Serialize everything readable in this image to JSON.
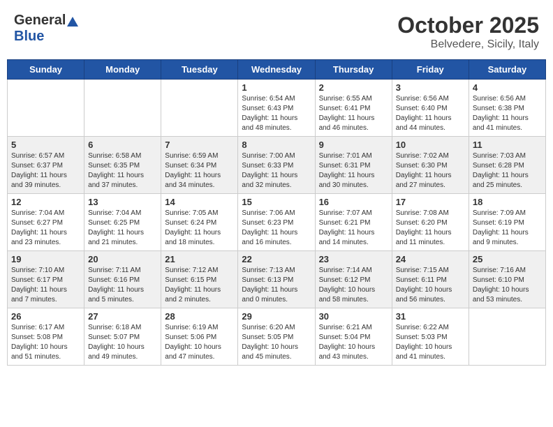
{
  "header": {
    "logo_general": "General",
    "logo_blue": "Blue",
    "month": "October 2025",
    "location": "Belvedere, Sicily, Italy"
  },
  "days_of_week": [
    "Sunday",
    "Monday",
    "Tuesday",
    "Wednesday",
    "Thursday",
    "Friday",
    "Saturday"
  ],
  "weeks": [
    {
      "shaded": false,
      "days": [
        {
          "num": "",
          "info": ""
        },
        {
          "num": "",
          "info": ""
        },
        {
          "num": "",
          "info": ""
        },
        {
          "num": "1",
          "info": "Sunrise: 6:54 AM\nSunset: 6:43 PM\nDaylight: 11 hours\nand 48 minutes."
        },
        {
          "num": "2",
          "info": "Sunrise: 6:55 AM\nSunset: 6:41 PM\nDaylight: 11 hours\nand 46 minutes."
        },
        {
          "num": "3",
          "info": "Sunrise: 6:56 AM\nSunset: 6:40 PM\nDaylight: 11 hours\nand 44 minutes."
        },
        {
          "num": "4",
          "info": "Sunrise: 6:56 AM\nSunset: 6:38 PM\nDaylight: 11 hours\nand 41 minutes."
        }
      ]
    },
    {
      "shaded": true,
      "days": [
        {
          "num": "5",
          "info": "Sunrise: 6:57 AM\nSunset: 6:37 PM\nDaylight: 11 hours\nand 39 minutes."
        },
        {
          "num": "6",
          "info": "Sunrise: 6:58 AM\nSunset: 6:35 PM\nDaylight: 11 hours\nand 37 minutes."
        },
        {
          "num": "7",
          "info": "Sunrise: 6:59 AM\nSunset: 6:34 PM\nDaylight: 11 hours\nand 34 minutes."
        },
        {
          "num": "8",
          "info": "Sunrise: 7:00 AM\nSunset: 6:33 PM\nDaylight: 11 hours\nand 32 minutes."
        },
        {
          "num": "9",
          "info": "Sunrise: 7:01 AM\nSunset: 6:31 PM\nDaylight: 11 hours\nand 30 minutes."
        },
        {
          "num": "10",
          "info": "Sunrise: 7:02 AM\nSunset: 6:30 PM\nDaylight: 11 hours\nand 27 minutes."
        },
        {
          "num": "11",
          "info": "Sunrise: 7:03 AM\nSunset: 6:28 PM\nDaylight: 11 hours\nand 25 minutes."
        }
      ]
    },
    {
      "shaded": false,
      "days": [
        {
          "num": "12",
          "info": "Sunrise: 7:04 AM\nSunset: 6:27 PM\nDaylight: 11 hours\nand 23 minutes."
        },
        {
          "num": "13",
          "info": "Sunrise: 7:04 AM\nSunset: 6:25 PM\nDaylight: 11 hours\nand 21 minutes."
        },
        {
          "num": "14",
          "info": "Sunrise: 7:05 AM\nSunset: 6:24 PM\nDaylight: 11 hours\nand 18 minutes."
        },
        {
          "num": "15",
          "info": "Sunrise: 7:06 AM\nSunset: 6:23 PM\nDaylight: 11 hours\nand 16 minutes."
        },
        {
          "num": "16",
          "info": "Sunrise: 7:07 AM\nSunset: 6:21 PM\nDaylight: 11 hours\nand 14 minutes."
        },
        {
          "num": "17",
          "info": "Sunrise: 7:08 AM\nSunset: 6:20 PM\nDaylight: 11 hours\nand 11 minutes."
        },
        {
          "num": "18",
          "info": "Sunrise: 7:09 AM\nSunset: 6:19 PM\nDaylight: 11 hours\nand 9 minutes."
        }
      ]
    },
    {
      "shaded": true,
      "days": [
        {
          "num": "19",
          "info": "Sunrise: 7:10 AM\nSunset: 6:17 PM\nDaylight: 11 hours\nand 7 minutes."
        },
        {
          "num": "20",
          "info": "Sunrise: 7:11 AM\nSunset: 6:16 PM\nDaylight: 11 hours\nand 5 minutes."
        },
        {
          "num": "21",
          "info": "Sunrise: 7:12 AM\nSunset: 6:15 PM\nDaylight: 11 hours\nand 2 minutes."
        },
        {
          "num": "22",
          "info": "Sunrise: 7:13 AM\nSunset: 6:13 PM\nDaylight: 11 hours\nand 0 minutes."
        },
        {
          "num": "23",
          "info": "Sunrise: 7:14 AM\nSunset: 6:12 PM\nDaylight: 10 hours\nand 58 minutes."
        },
        {
          "num": "24",
          "info": "Sunrise: 7:15 AM\nSunset: 6:11 PM\nDaylight: 10 hours\nand 56 minutes."
        },
        {
          "num": "25",
          "info": "Sunrise: 7:16 AM\nSunset: 6:10 PM\nDaylight: 10 hours\nand 53 minutes."
        }
      ]
    },
    {
      "shaded": false,
      "days": [
        {
          "num": "26",
          "info": "Sunrise: 6:17 AM\nSunset: 5:08 PM\nDaylight: 10 hours\nand 51 minutes."
        },
        {
          "num": "27",
          "info": "Sunrise: 6:18 AM\nSunset: 5:07 PM\nDaylight: 10 hours\nand 49 minutes."
        },
        {
          "num": "28",
          "info": "Sunrise: 6:19 AM\nSunset: 5:06 PM\nDaylight: 10 hours\nand 47 minutes."
        },
        {
          "num": "29",
          "info": "Sunrise: 6:20 AM\nSunset: 5:05 PM\nDaylight: 10 hours\nand 45 minutes."
        },
        {
          "num": "30",
          "info": "Sunrise: 6:21 AM\nSunset: 5:04 PM\nDaylight: 10 hours\nand 43 minutes."
        },
        {
          "num": "31",
          "info": "Sunrise: 6:22 AM\nSunset: 5:03 PM\nDaylight: 10 hours\nand 41 minutes."
        },
        {
          "num": "",
          "info": ""
        }
      ]
    }
  ]
}
